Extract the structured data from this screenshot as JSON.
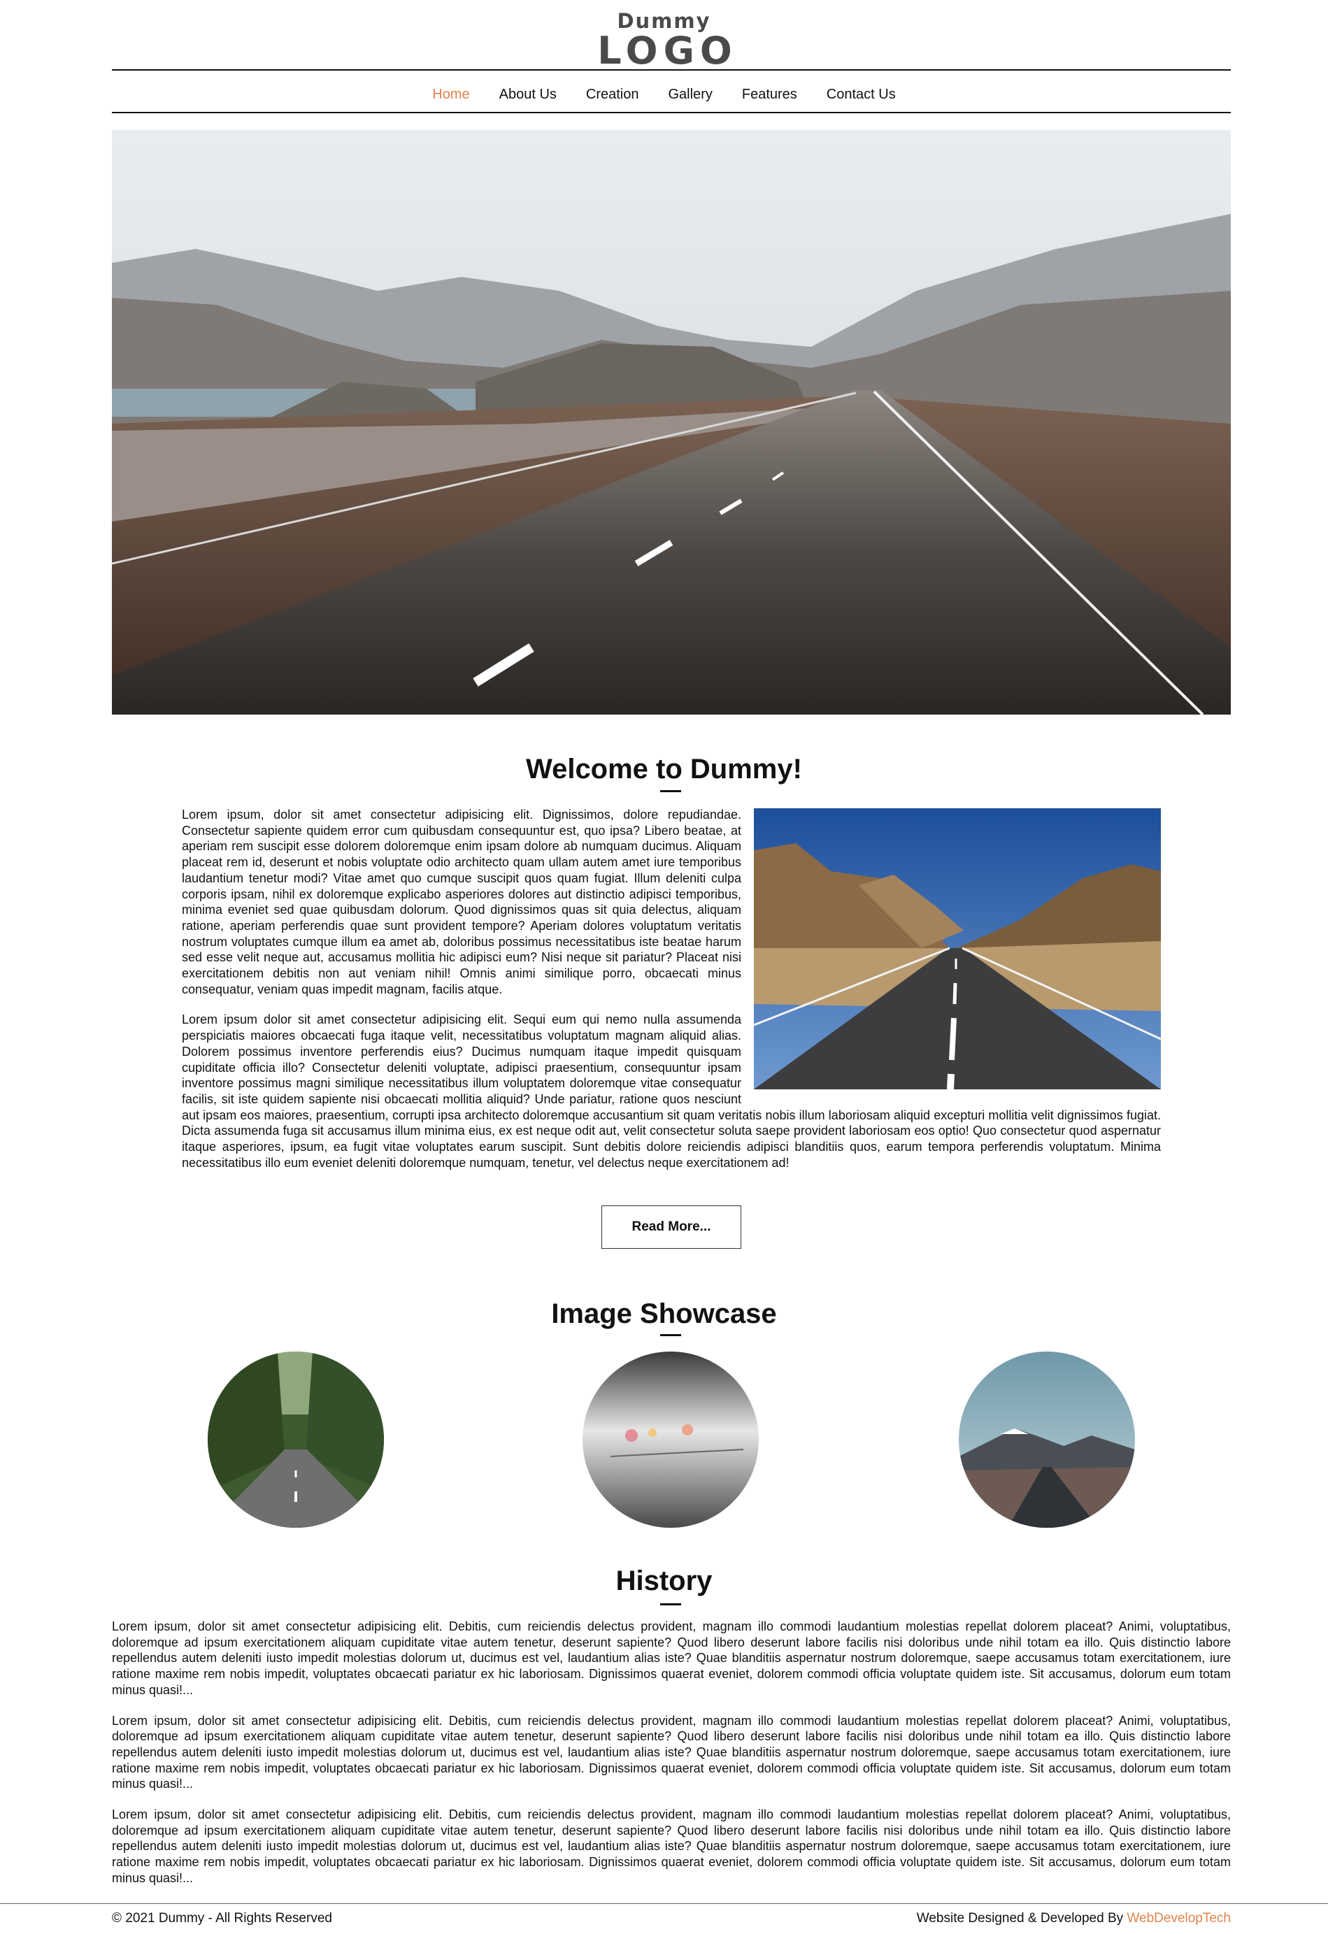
{
  "brand": {
    "logo_top": "Dummy",
    "logo_main": "LOGO"
  },
  "nav": {
    "items": [
      {
        "label": "Home",
        "active": true
      },
      {
        "label": "About Us"
      },
      {
        "label": "Creation"
      },
      {
        "label": "Gallery"
      },
      {
        "label": "Features"
      },
      {
        "label": "Contact Us"
      }
    ]
  },
  "colors": {
    "accent": "#e0844a",
    "text": "#111111"
  },
  "welcome": {
    "heading": "Welcome to Dummy!",
    "p1": "Lorem ipsum, dolor sit amet consectetur adipisicing elit. Dignissimos, dolore repudiandae. Consectetur sapiente quidem error cum quibusdam consequuntur est, quo ipsa? Libero beatae, at aperiam rem suscipit esse dolorem doloremque enim ipsam dolore ab numquam ducimus. Aliquam placeat rem id, deserunt et nobis voluptate odio architecto quam ullam autem amet iure temporibus laudantium tenetur modi? Vitae amet quo cumque suscipit quos quam fugiat. Illum deleniti culpa corporis ipsam, nihil ex doloremque explicabo asperiores dolores aut distinctio adipisci temporibus, minima eveniet sed quae quibusdam dolorum. Quod dignissimos quas sit quia delectus, aliquam ratione, aperiam perferendis quae sunt provident tempore? Aperiam dolores voluptatum veritatis nostrum voluptates cumque illum ea amet ab, doloribus possimus necessitatibus iste beatae harum sed esse velit neque aut, accusamus mollitia hic adipisci eum? Nisi neque sit pariatur? Placeat nisi exercitationem debitis non aut veniam nihil! Omnis animi similique porro, obcaecati minus consequatur, veniam quas impedit magnam, facilis atque.",
    "p2": "Lorem ipsum dolor sit amet consectetur adipisicing elit. Sequi eum qui nemo nulla assumenda perspiciatis maiores obcaecati fuga itaque velit, necessitatibus voluptatum magnam aliquid alias. Dolorem possimus inventore perferendis eius? Ducimus numquam itaque impedit quisquam cupiditate officia illo? Consectetur deleniti voluptate, adipisci praesentium, consequuntur ipsam inventore possimus magni similique necessitatibus illum voluptatem doloremque vitae consequatur facilis, sit iste quidem sapiente nisi obcaecati mollitia aliquid? Unde pariatur, ratione quos nesciunt aut ipsam eos maiores, praesentium, corrupti ipsa architecto doloremque accusantium sit quam veritatis nobis illum laboriosam aliquid excepturi mollitia velit dignissimos fugiat. Dicta assumenda fuga sit accusamus illum minima eius, ex est neque odit aut, velit consectetur soluta saepe provident laboriosam eos optio! Quo consectetur quod aspernatur itaque asperiores, ipsum, ea fugit vitae voluptates earum suscipit. Sunt debitis dolore reiciendis adipisci blanditiis quos, earum tempora perferendis voluptatum. Minima necessitatibus illo eum eveniet deleniti doloremque numquam, tenetur, vel delectus neque exercitationem ad!",
    "read_more": "Read More..."
  },
  "showcase": {
    "heading": "Image Showcase"
  },
  "history": {
    "heading": "History",
    "paragraphs": [
      "Lorem ipsum, dolor sit amet consectetur adipisicing elit. Debitis, cum reiciendis delectus provident, magnam illo commodi laudantium molestias repellat dolorem placeat? Animi, voluptatibus, doloremque ad ipsum exercitationem aliquam cupiditate vitae autem tenetur, deserunt sapiente? Quod libero deserunt labore facilis nisi doloribus unde nihil totam ea illo. Quis distinctio labore repellendus autem deleniti iusto impedit molestias dolorum ut, ducimus est vel, laudantium alias iste? Quae blanditiis aspernatur nostrum doloremque, saepe accusamus totam exercitationem, iure ratione maxime rem nobis impedit, voluptates obcaecati pariatur ex hic laboriosam. Dignissimos quaerat eveniet, dolorem commodi officia voluptate quidem iste. Sit accusamus, dolorum eum totam minus quasi!...",
      "Lorem ipsum, dolor sit amet consectetur adipisicing elit. Debitis, cum reiciendis delectus provident, magnam illo commodi laudantium molestias repellat dolorem placeat? Animi, voluptatibus, doloremque ad ipsum exercitationem aliquam cupiditate vitae autem tenetur, deserunt sapiente? Quod libero deserunt labore facilis nisi doloribus unde nihil totam ea illo. Quis distinctio labore repellendus autem deleniti iusto impedit molestias dolorum ut, ducimus est vel, laudantium alias iste? Quae blanditiis aspernatur nostrum doloremque, saepe accusamus totam exercitationem, iure ratione maxime rem nobis impedit, voluptates obcaecati pariatur ex hic laboriosam. Dignissimos quaerat eveniet, dolorem commodi officia voluptate quidem iste. Sit accusamus, dolorum eum totam minus quasi!...",
      "Lorem ipsum, dolor sit amet consectetur adipisicing elit. Debitis, cum reiciendis delectus provident, magnam illo commodi laudantium molestias repellat dolorem placeat? Animi, voluptatibus, doloremque ad ipsum exercitationem aliquam cupiditate vitae autem tenetur, deserunt sapiente? Quod libero deserunt labore facilis nisi doloribus unde nihil totam ea illo. Quis distinctio labore repellendus autem deleniti iusto impedit molestias dolorum ut, ducimus est vel, laudantium alias iste? Quae blanditiis aspernatur nostrum doloremque, saepe accusamus totam exercitationem, iure ratione maxime rem nobis impedit, voluptates obcaecati pariatur ex hic laboriosam. Dignissimos quaerat eveniet, dolorem commodi officia voluptate quidem iste. Sit accusamus, dolorum eum totam minus quasi!..."
    ]
  },
  "footer": {
    "copyright": "© 2021 Dummy - All Rights Reserved",
    "credit_prefix": "Website Designed & Developed By",
    "credit_link": "WebDevelopTech"
  }
}
